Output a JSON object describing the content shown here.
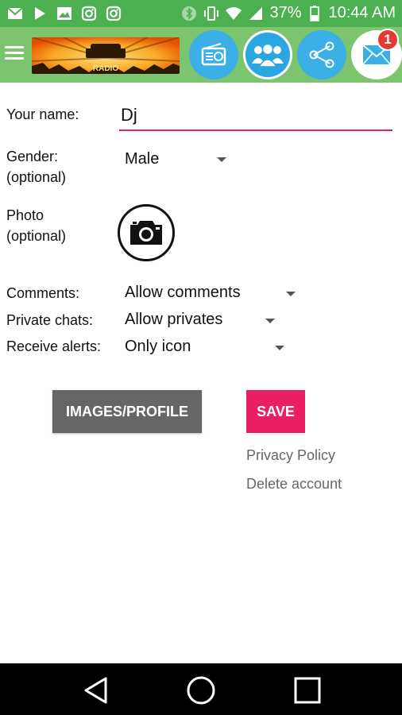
{
  "status_bar": {
    "left_icons": [
      "mail-icon",
      "play-icon",
      "image-icon",
      "instagram-icon",
      "instagram-icon"
    ],
    "right_icons": [
      "bluetooth-icon",
      "vibrate-icon",
      "wifi-icon",
      "signal-icon",
      "battery-icon"
    ],
    "battery": "37%",
    "time": "10:44 AM"
  },
  "toolbar": {
    "menu_icon": "hamburger-menu-icon",
    "logo_text": "RADIO",
    "buttons": [
      "radio-icon",
      "users-icon",
      "share-icon",
      "mail-icon"
    ],
    "mail_badge": "1",
    "colors": {
      "bar": "#7dc46f",
      "circle": "#3ab0e6",
      "badge": "#e53935"
    }
  },
  "form": {
    "name_label": "Your name:",
    "name_value": "Dj",
    "gender_label": "Gender:",
    "gender_sub": "(optional)",
    "gender_value": "Male",
    "photo_label": "Photo",
    "photo_sub": "(optional)",
    "comments_label": "Comments:",
    "comments_value": "Allow comments",
    "private_label": "Private chats:",
    "private_value": "Allow privates",
    "alerts_label": "Receive alerts:",
    "alerts_value": "Only icon"
  },
  "actions": {
    "images_label": "IMAGES/PROFILE",
    "save_label": "SAVE",
    "privacy_label": "Privacy Policy",
    "delete_label": "Delete account",
    "colors": {
      "save": "#e91e63",
      "images": "#666666",
      "input_line": "#e0245e"
    }
  },
  "nav": {
    "buttons": [
      "back-icon",
      "home-icon",
      "recents-icon"
    ]
  }
}
